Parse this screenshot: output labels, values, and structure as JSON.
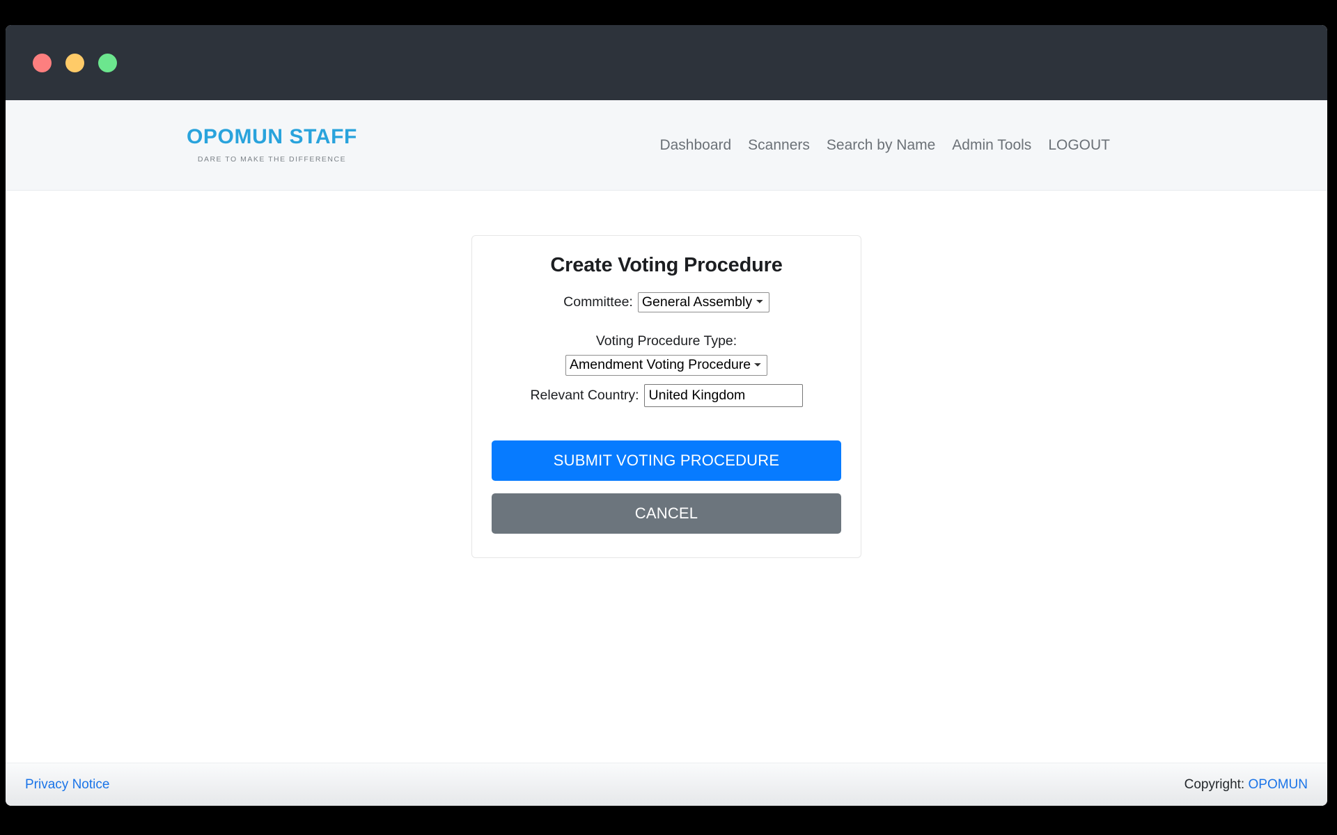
{
  "window": {
    "traffic_lights": [
      {
        "name": "close",
        "color": "#fd7f7f"
      },
      {
        "name": "minimize",
        "color": "#ffcb68"
      },
      {
        "name": "maximize",
        "color": "#6ce68e"
      }
    ]
  },
  "header": {
    "brand_name": "OPOMUN STAFF",
    "brand_tagline": "DARE TO MAKE THE DIFFERENCE",
    "brand_color": "#29a3dc",
    "nav": [
      {
        "label": "Dashboard"
      },
      {
        "label": "Scanners"
      },
      {
        "label": "Search by Name"
      },
      {
        "label": "Admin Tools"
      },
      {
        "label": "LOGOUT"
      }
    ]
  },
  "card": {
    "title": "Create Voting Procedure",
    "committee": {
      "label": "Committee:",
      "value": "General Assembly",
      "options": [
        "General Assembly"
      ]
    },
    "procedure_type": {
      "label": "Voting Procedure Type:",
      "value": "Amendment Voting Procedure",
      "options": [
        "Amendment Voting Procedure"
      ]
    },
    "relevant_country": {
      "label": "Relevant Country:",
      "value": "United Kingdom",
      "placeholder": ""
    },
    "submit_label": "SUBMIT VOTING PROCEDURE",
    "cancel_label": "CANCEL",
    "submit_color": "#077bff",
    "cancel_color": "#6c757d"
  },
  "footer": {
    "privacy_label": "Privacy Notice",
    "copyright_prefix": "Copyright:",
    "copyright_link": "OPOMUN",
    "link_color": "#1a74e8"
  }
}
